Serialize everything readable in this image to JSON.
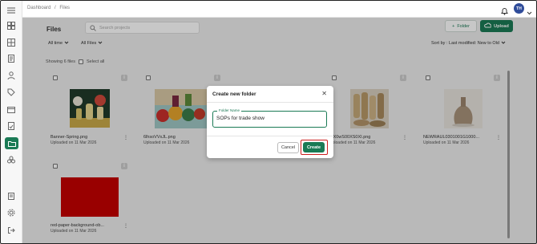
{
  "breadcrumb": {
    "root": "Dashboard",
    "separator": "/",
    "current": "Files"
  },
  "user": {
    "initials": "TH"
  },
  "files": {
    "title": "Files",
    "search_placeholder": "Search projects",
    "folder_button": "Folder",
    "upload_button": "Upload",
    "filters": {
      "time": "All time",
      "type": "All Files"
    },
    "sort_label": "Sort by : Last modified: New to Old",
    "showing": "Showing 6 files",
    "select_all": "Select all",
    "cards": [
      {
        "name": "Banner-Spring.png",
        "date": "Uploaded on 11 Mar 2026",
        "thumb": "vases"
      },
      {
        "name": "6lhsoVVxJL.png",
        "date": "Uploaded on 11 Mar 2026",
        "thumb": "painted-pots"
      },
      {
        "name": "",
        "date": "",
        "thumb": "hidden"
      },
      {
        "name": "...X0wS00XS0XI.png",
        "date": "Uploaded on 11 Mar 2026",
        "thumb": "bamboo"
      },
      {
        "name": "NEWRAUL0301001G1000...",
        "date": "Uploaded on 11 Mar 2026",
        "thumb": "ceramic"
      },
      {
        "name": "red-paper-background-ob...",
        "date": "Uploaded on 11 Mar 2026",
        "thumb": "red"
      }
    ]
  },
  "modal": {
    "title": "Create new folder",
    "field_label": "Folder Name",
    "field_value": "SOPs for trade show",
    "cancel": "Cancel",
    "create": "Create"
  },
  "colors": {
    "brand": "#1a7a55",
    "highlight": "#cc1f1f",
    "avatar": "#2f4c9a"
  }
}
